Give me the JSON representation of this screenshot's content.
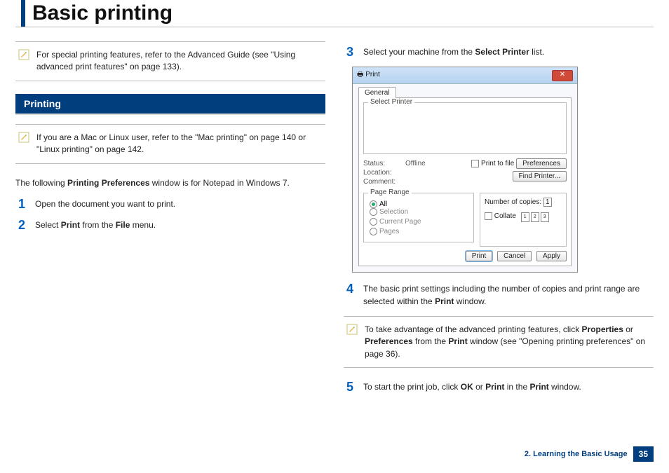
{
  "title": "Basic printing",
  "note1": "For special printing features, refer to the Advanced Guide (see \"Using advanced print features\" on page 133).",
  "section": "Printing",
  "note2": "If you are a Mac or Linux user, refer to the \"Mac printing\" on page 140 or \"Linux printing\" on page 142.",
  "intro_a": "The following ",
  "intro_b": "Printing Preferences",
  "intro_c": " window is for Notepad in Windows 7.",
  "s1": "Open the document you want to print.",
  "s2a": "Select ",
  "s2b": "Print",
  "s2c": " from the ",
  "s2d": "File",
  "s2e": " menu.",
  "s3a": "Select your machine from the ",
  "s3b": "Select Printer",
  "s3c": " list.",
  "s4a": "The basic print settings including the number of copies and print range are selected within the ",
  "s4b": "Print",
  "s4c": " window.",
  "note3a": "To take advantage of the advanced printing features, click ",
  "note3b": "Properties",
  "note3c": " or ",
  "note3d": "Preferences",
  "note3e": " from the ",
  "note3f": "Print",
  "note3g": " window (see \"Opening printing preferences\" on page 36).",
  "s5a": "To start the print job, click ",
  "s5b": "OK",
  "s5c": " or ",
  "s5d": "Print",
  "s5e": " in the ",
  "s5f": "Print",
  "s5g": " window.",
  "dlg": {
    "title": "Print",
    "tab": "General",
    "group1": "Select Printer",
    "status_k": "Status:",
    "status_v": "Offline",
    "loc_k": "Location:",
    "com_k": "Comment:",
    "ptf": "Print to file",
    "pref": "Preferences",
    "findp": "Find Printer...",
    "range": "Page Range",
    "all": "All",
    "sel": "Selection",
    "cur": "Current Page",
    "pages": "Pages",
    "copies": "Number of copies:",
    "copies_v": "1",
    "collate": "Collate",
    "print": "Print",
    "cancel": "Cancel",
    "apply": "Apply"
  },
  "footer": {
    "chapter": "2. Learning the Basic Usage",
    "page": "35"
  }
}
